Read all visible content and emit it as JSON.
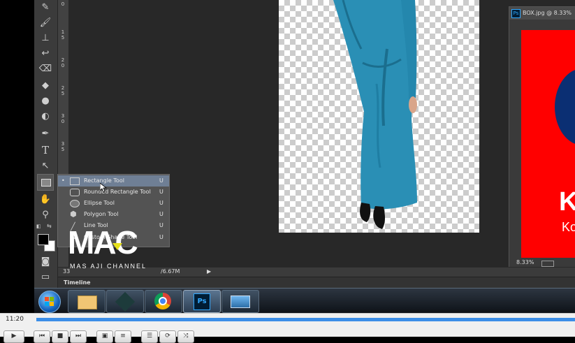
{
  "ruler": {
    "marks": [
      "0",
      "1\n5",
      "2\n0",
      "2\n5",
      "3\n0",
      "3\n5"
    ]
  },
  "tool_flyout": {
    "items": [
      {
        "label": "Rectangle Tool",
        "shortcut": "U"
      },
      {
        "label": "Rounded Rectangle Tool",
        "shortcut": "U"
      },
      {
        "label": "Ellipse Tool",
        "shortcut": "U"
      },
      {
        "label": "Polygon Tool",
        "shortcut": "U"
      },
      {
        "label": "Line Tool",
        "shortcut": "U"
      },
      {
        "label": "Custom Shape Tool",
        "shortcut": "U"
      }
    ]
  },
  "doc2": {
    "title": "BOX.jpg @ 8.33%",
    "zoom": "8.33%",
    "art_text_1": "K",
    "art_text_2": "Ko"
  },
  "status": {
    "zoom": "33",
    "doc_size": "/6.67M"
  },
  "panels": {
    "timeline": "Timeline"
  },
  "watermark": {
    "logo": "MAC",
    "channel": "MAS AJI CHANNEL"
  },
  "vlc": {
    "time": "11:20"
  },
  "colors": {
    "accent_blue": "#3c8ee7",
    "flyout_selected": "#6f7f95",
    "photoshop_blue": "#31a8ff"
  }
}
